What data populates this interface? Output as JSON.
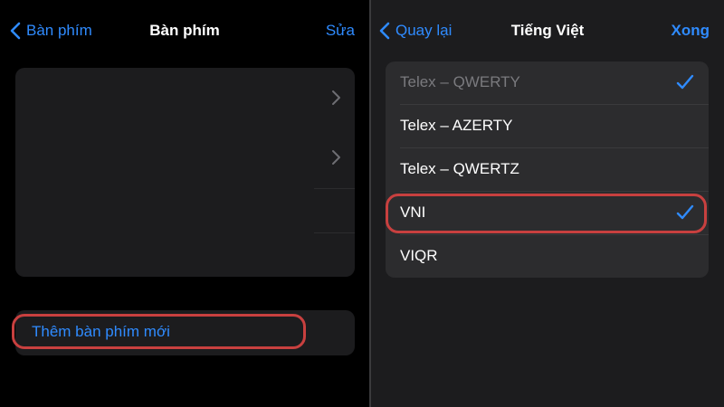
{
  "left": {
    "nav": {
      "back_label": "Bàn phím",
      "title": "Bàn phím",
      "edit_label": "Sửa"
    },
    "add_keyboard_label": "Thêm bàn phím mới"
  },
  "right": {
    "nav": {
      "back_label": "Quay lại",
      "title": "Tiếng Việt",
      "done_label": "Xong"
    },
    "layouts": [
      {
        "label": "Telex – QWERTY",
        "checked": true,
        "disabled": true
      },
      {
        "label": "Telex – AZERTY",
        "checked": false,
        "disabled": false
      },
      {
        "label": "Telex – QWERTZ",
        "checked": false,
        "disabled": false
      },
      {
        "label": "VNI",
        "checked": true,
        "disabled": false
      },
      {
        "label": "VIQR",
        "checked": false,
        "disabled": false
      }
    ]
  },
  "colors": {
    "accent": "#2f8bff",
    "highlight": "#c8403f",
    "background": "#000000",
    "cell": "#1c1c1e"
  },
  "icons": [
    "chevron-left-icon",
    "chevron-right-icon",
    "checkmark-icon"
  ]
}
